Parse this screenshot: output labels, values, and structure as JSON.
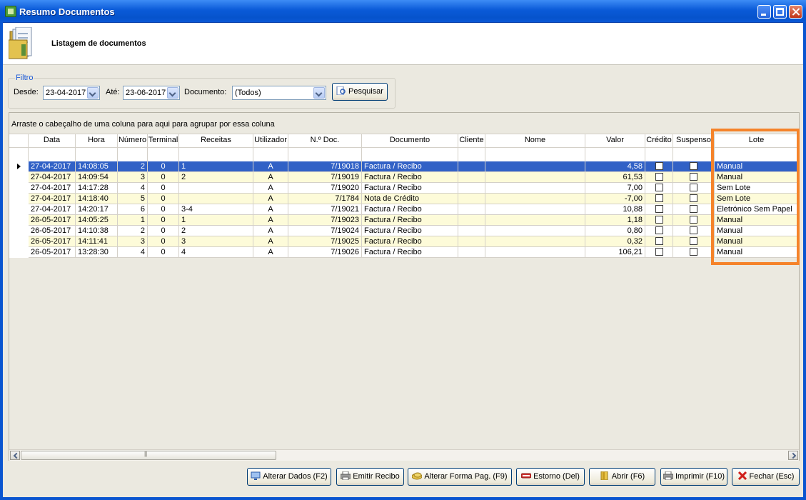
{
  "window": {
    "title": "Resumo Documentos"
  },
  "header": {
    "title": "Listagem de documentos"
  },
  "filter": {
    "legend": "Filtro",
    "desde_label": "Desde:",
    "desde_value": "23-04-2017",
    "ate_label": "Até:",
    "ate_value": "23-06-2017",
    "documento_label": "Documento:",
    "documento_value": "(Todos)",
    "search_label": "Pesquisar"
  },
  "grid": {
    "group_hint": "Arraste o cabeçalho de uma coluna para aqui para agrupar por essa coluna",
    "columns": [
      "Data",
      "Hora",
      "Número",
      "Terminal",
      "Receitas",
      "Utilizador",
      "N.º Doc.",
      "Documento",
      "Cliente",
      "Nome",
      "Valor",
      "Crédito",
      "Suspenso",
      "Lote"
    ],
    "rows": [
      {
        "data": "27-04-2017",
        "hora": "14:08:05",
        "numero": "2",
        "terminal": "0",
        "receitas": "1",
        "utilizador": "A",
        "ndoc": "7/19018",
        "documento": "Factura / Recibo",
        "cliente": "",
        "nome": "",
        "valor": "4,58",
        "lote": "Manual"
      },
      {
        "data": "27-04-2017",
        "hora": "14:09:54",
        "numero": "3",
        "terminal": "0",
        "receitas": "2",
        "utilizador": "A",
        "ndoc": "7/19019",
        "documento": "Factura / Recibo",
        "cliente": "",
        "nome": "",
        "valor": "61,53",
        "lote": "Manual"
      },
      {
        "data": "27-04-2017",
        "hora": "14:17:28",
        "numero": "4",
        "terminal": "0",
        "receitas": "",
        "utilizador": "A",
        "ndoc": "7/19020",
        "documento": "Factura / Recibo",
        "cliente": "",
        "nome": "",
        "valor": "7,00",
        "lote": "Sem Lote"
      },
      {
        "data": "27-04-2017",
        "hora": "14:18:40",
        "numero": "5",
        "terminal": "0",
        "receitas": "",
        "utilizador": "A",
        "ndoc": "7/1784",
        "documento": "Nota de Crédito",
        "cliente": "",
        "nome": "",
        "valor": "-7,00",
        "lote": "Sem Lote"
      },
      {
        "data": "27-04-2017",
        "hora": "14:20:17",
        "numero": "6",
        "terminal": "0",
        "receitas": "3-4",
        "utilizador": "A",
        "ndoc": "7/19021",
        "documento": "Factura / Recibo",
        "cliente": "",
        "nome": "",
        "valor": "10,88",
        "lote": "Eletrónico Sem Papel"
      },
      {
        "data": "26-05-2017",
        "hora": "14:05:25",
        "numero": "1",
        "terminal": "0",
        "receitas": "1",
        "utilizador": "A",
        "ndoc": "7/19023",
        "documento": "Factura / Recibo",
        "cliente": "",
        "nome": "",
        "valor": "1,18",
        "lote": "Manual"
      },
      {
        "data": "26-05-2017",
        "hora": "14:10:38",
        "numero": "2",
        "terminal": "0",
        "receitas": "2",
        "utilizador": "A",
        "ndoc": "7/19024",
        "documento": "Factura / Recibo",
        "cliente": "",
        "nome": "",
        "valor": "0,80",
        "lote": "Manual"
      },
      {
        "data": "26-05-2017",
        "hora": "14:11:41",
        "numero": "3",
        "terminal": "0",
        "receitas": "3",
        "utilizador": "A",
        "ndoc": "7/19025",
        "documento": "Factura / Recibo",
        "cliente": "",
        "nome": "",
        "valor": "0,32",
        "lote": "Manual"
      },
      {
        "data": "26-05-2017",
        "hora": "13:28:30",
        "numero": "4",
        "terminal": "0",
        "receitas": "4",
        "utilizador": "A",
        "ndoc": "7/19026",
        "documento": "Factura / Recibo",
        "cliente": "",
        "nome": "",
        "valor": "106,21",
        "lote": "Manual"
      }
    ]
  },
  "buttons": {
    "alterar_dados": "Alterar Dados (F2)",
    "emitir_recibo": "Emitir Recibo",
    "alterar_forma": "Alterar Forma Pag. (F9)",
    "estorno": "Estorno (Del)",
    "abrir": "Abrir (F6)",
    "imprimir": "Imprimir (F10)",
    "fechar": "Fechar (Esc)"
  },
  "colors": {
    "selection": "#3161c6",
    "alt_row": "#fdfbd9",
    "highlight": "#f5832a",
    "title_bar": "#0a5ad8"
  }
}
